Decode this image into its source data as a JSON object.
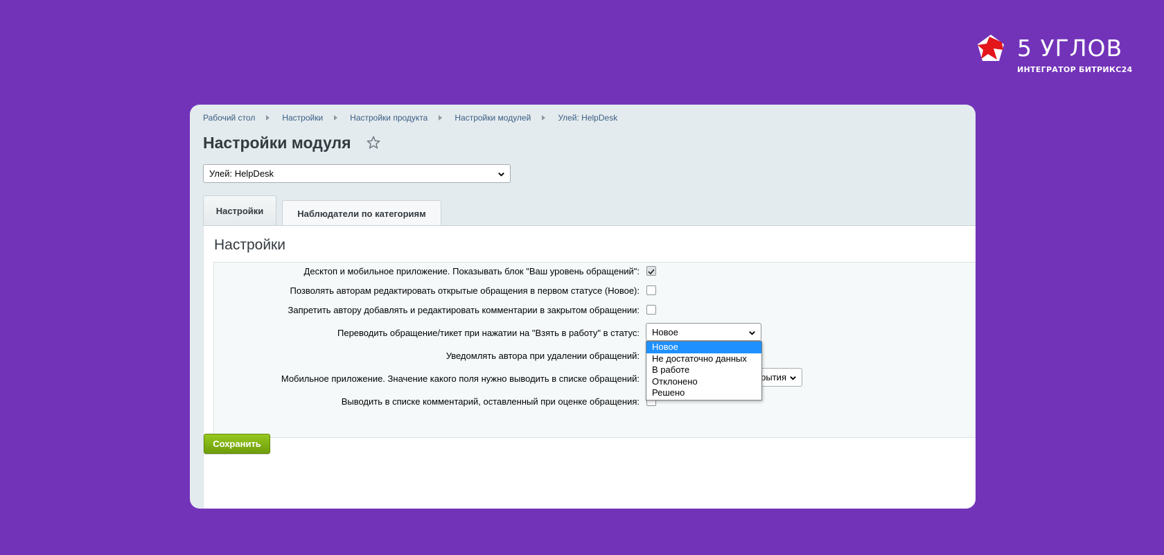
{
  "brand": {
    "name": "5 УГЛОВ",
    "subtitle": "ИНТЕГРАТОР БИТРИКС24",
    "mark_icon": "red-pentagon-star-icon"
  },
  "breadcrumb": [
    "Рабочий стол",
    "Настройки",
    "Настройки продукта",
    "Настройки модулей",
    "Улей: HelpDesk"
  ],
  "page_title": "Настройки модуля",
  "module_select": {
    "value": "Улей: HelpDesk"
  },
  "tabs": [
    {
      "label": "Настройки",
      "active": true
    },
    {
      "label": "Наблюдатели по категориям",
      "active": false
    }
  ],
  "section_title": "Настройки",
  "settings": [
    {
      "label": "Десктоп и мобильное приложение. Показывать блок \"Ваш уровень обращений\":",
      "type": "checkbox",
      "checked": true
    },
    {
      "label": "Позволять авторам редактировать открытые обращения в первом статусе (Новое):",
      "type": "checkbox",
      "checked": false
    },
    {
      "label": "Запретить автору добавлять и редактировать комментарии в закрытом обращении:",
      "type": "checkbox",
      "checked": false
    },
    {
      "label": "Переводить обращение/тикет при нажатии на \"Взять в работу\" в статус:",
      "type": "select",
      "value": "Новое"
    },
    {
      "label": "Уведомлять автора при удалении обращений:",
      "type": "checkbox",
      "checked": false
    },
    {
      "label": "Мобильное приложение. Значение какого поля нужно выводить в списке обращений:",
      "type": "select",
      "value": "рытия"
    },
    {
      "label": "Выводить в списке комментарий, оставленный при оценке обращения:",
      "type": "checkbox",
      "checked": false
    }
  ],
  "status_dropdown": {
    "options": [
      "Новое",
      "Не достаточно данных",
      "В работе",
      "Отклонено",
      "Решено"
    ],
    "selected_index": 0
  },
  "save_label": "Сохранить",
  "colors": {
    "background": "#7233b9",
    "card": "#e4ebee",
    "link": "#3a5d84",
    "save_button": "#84b516",
    "dropdown_highlight": "#1e90ff"
  }
}
